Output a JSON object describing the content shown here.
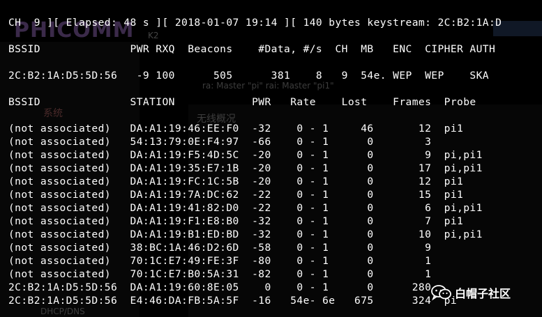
{
  "background_ghost": {
    "brand": "PHICOMM",
    "model": "K2",
    "menu_system": "系统",
    "status_title": "无线概况",
    "ssid_line": "ra: Master \"pi\"     rai: Master \"pi1\"",
    "dhcp": "DHCP/DNS"
  },
  "status_line": "CH  9 ][ Elapsed: 48 s ][ 2018-01-07 19:14 ][ 140 bytes keystream: 2C:B2:1A:D",
  "ap_table": {
    "header": "BSSID              PWR RXQ  Beacons    #Data, #/s  CH  MB   ENC  CIPHER AUTH",
    "rows": [
      "2C:B2:1A:D5:5D:56   -9 100      505      381    8   9  54e. WEP  WEP    SKA"
    ]
  },
  "station_table": {
    "header": "BSSID              STATION            PWR   Rate    Lost    Frames  Probe",
    "rows": [
      "(not associated)   DA:A1:19:46:EE:F0  -32    0 - 1     46       12  pi1",
      "(not associated)   54:13:79:0E:F4:97  -66    0 - 1      0        3",
      "(not associated)   DA:A1:19:F5:4D:5C  -20    0 - 1      0        9  pi,pi1",
      "(not associated)   DA:A1:19:35:E7:1B  -20    0 - 1      0       17  pi,pi1",
      "(not associated)   DA:A1:19:FC:1C:5B  -20    0 - 1      0       12  pi1",
      "(not associated)   DA:A1:19:7A:DC:62  -22    0 - 1      0       15  pi1",
      "(not associated)   DA:A1:19:41:82:D0  -22    0 - 1      0        6  pi,pi1",
      "(not associated)   DA:A1:19:F1:E8:B0  -32    0 - 1      0        7  pi1",
      "(not associated)   DA:A1:19:B1:ED:BD  -32    0 - 1      0       10  pi,pi1",
      "(not associated)   38:BC:1A:46:D2:6D  -58    0 - 1      0        9",
      "(not associated)   70:1C:E7:49:FE:3F  -80    0 - 1      0        1",
      "(not associated)   70:1C:E7:B0:5A:31  -82    0 - 1      0        1",
      "2C:B2:1A:D5:5D:56  DA:A1:19:60:8E:05    0    0 - 1      0      280",
      "2C:B2:1A:D5:5D:56  E4:46:DA:FB:5A:5F  -16   54e- 6e   675      324  pi"
    ]
  },
  "watermark": {
    "text": "白帽子社区",
    "icon": "wechat-icon"
  },
  "colors": {
    "terminal_bg": "#000000",
    "terminal_fg": "#ffffff"
  }
}
